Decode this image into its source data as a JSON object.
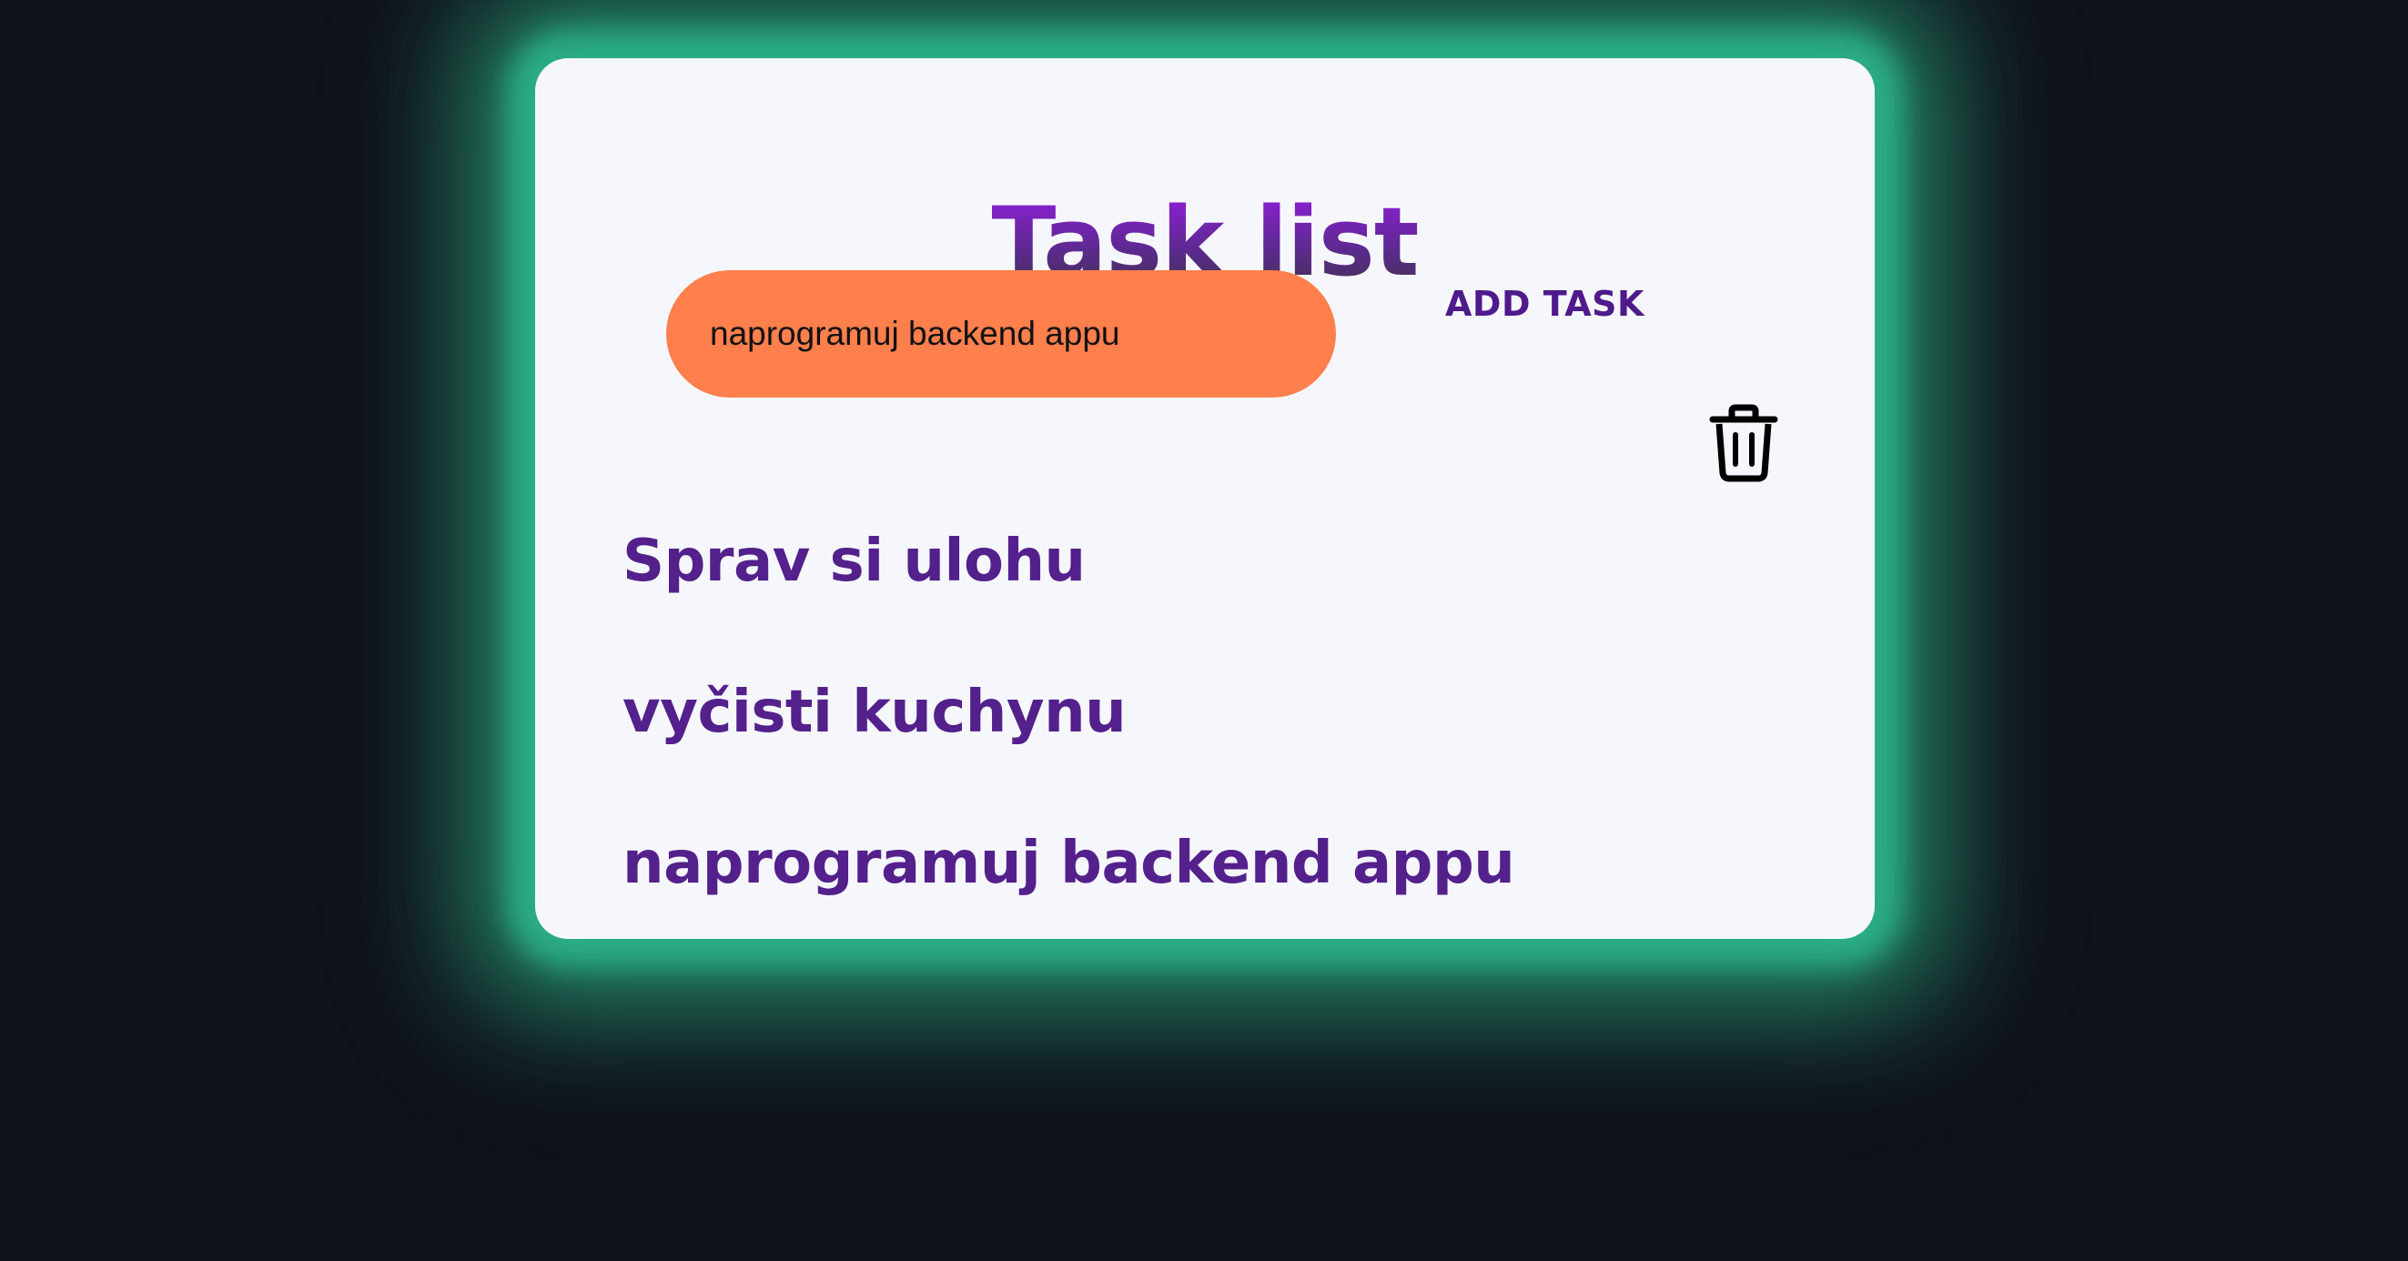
{
  "app": {
    "title": "Task list"
  },
  "form": {
    "input_value": "naprogramuj backend appu",
    "add_label": "ADD TASK"
  },
  "icons": {
    "delete": "trash-icon"
  },
  "tasks": [
    "Sprav si ulohu",
    "vyčisti kuchynu",
    "naprogramuj backend appu"
  ],
  "colors": {
    "background": "#10121a",
    "glow": "#2bad84",
    "card": "#f6f7fc",
    "input": "#ff7f4d",
    "accent": "#53208c",
    "title_top": "#8d1fd6",
    "title_bottom": "#43324f"
  }
}
